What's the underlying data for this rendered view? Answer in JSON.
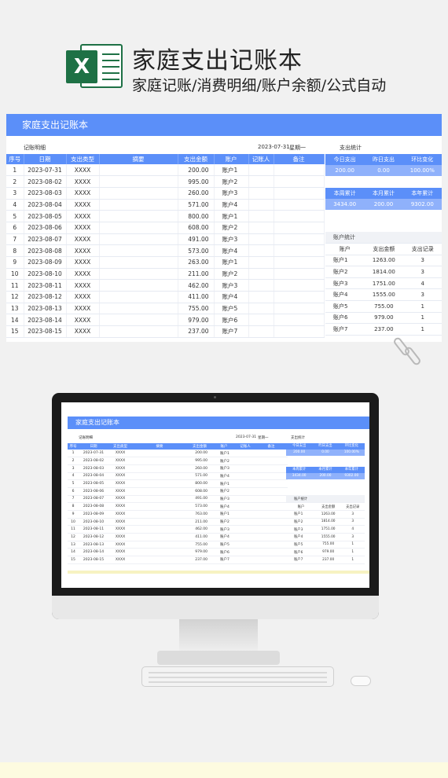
{
  "banner": {
    "logo_letter": "X",
    "title": "家庭支出记账本",
    "subtitle": "家庭记账/消费明细/账户余额/公式自动"
  },
  "sheet": {
    "title": "家庭支出记账本",
    "section_label": "记账明细",
    "date": "2023-07-31",
    "weekday": "星期一",
    "stats_label": "支出统计",
    "columns": [
      "序号",
      "日期",
      "支出类型",
      "摘要",
      "支出金额",
      "账户",
      "记账人",
      "备注"
    ],
    "rows": [
      {
        "no": "1",
        "date": "2023-07-31",
        "type": "XXXX",
        "amount": "200.00",
        "account": "账户1"
      },
      {
        "no": "2",
        "date": "2023-08-02",
        "type": "XXXX",
        "amount": "995.00",
        "account": "账户2"
      },
      {
        "no": "3",
        "date": "2023-08-03",
        "type": "XXXX",
        "amount": "260.00",
        "account": "账户3"
      },
      {
        "no": "4",
        "date": "2023-08-04",
        "type": "XXXX",
        "amount": "571.00",
        "account": "账户4"
      },
      {
        "no": "5",
        "date": "2023-08-05",
        "type": "XXXX",
        "amount": "800.00",
        "account": "账户1"
      },
      {
        "no": "6",
        "date": "2023-08-06",
        "type": "XXXX",
        "amount": "608.00",
        "account": "账户2"
      },
      {
        "no": "7",
        "date": "2023-08-07",
        "type": "XXXX",
        "amount": "491.00",
        "account": "账户3"
      },
      {
        "no": "8",
        "date": "2023-08-08",
        "type": "XXXX",
        "amount": "573.00",
        "account": "账户4"
      },
      {
        "no": "9",
        "date": "2023-08-09",
        "type": "XXXX",
        "amount": "263.00",
        "account": "账户1"
      },
      {
        "no": "10",
        "date": "2023-08-10",
        "type": "XXXX",
        "amount": "211.00",
        "account": "账户2"
      },
      {
        "no": "11",
        "date": "2023-08-11",
        "type": "XXXX",
        "amount": "462.00",
        "account": "账户3"
      },
      {
        "no": "12",
        "date": "2023-08-12",
        "type": "XXXX",
        "amount": "411.00",
        "account": "账户4"
      },
      {
        "no": "13",
        "date": "2023-08-13",
        "type": "XXXX",
        "amount": "755.00",
        "account": "账户5"
      },
      {
        "no": "14",
        "date": "2023-08-14",
        "type": "XXXX",
        "amount": "979.00",
        "account": "账户6"
      },
      {
        "no": "15",
        "date": "2023-08-15",
        "type": "XXXX",
        "amount": "237.00",
        "account": "账户7"
      }
    ],
    "stats1": {
      "labels": [
        "今日支出",
        "昨日支出",
        "环比变化"
      ],
      "values": [
        "200.00",
        "0.00",
        "100.00%"
      ]
    },
    "stats2": {
      "labels": [
        "本周累计",
        "本月累计",
        "本年累计"
      ],
      "values": [
        "3434.00",
        "200.00",
        "9302.00"
      ]
    },
    "account_stats": {
      "title": "账户统计",
      "headers": [
        "账户",
        "支出金额",
        "支出记录"
      ],
      "rows": [
        {
          "name": "账户1",
          "amount": "1263.00",
          "count": "3"
        },
        {
          "name": "账户2",
          "amount": "1814.00",
          "count": "3"
        },
        {
          "name": "账户3",
          "amount": "1751.00",
          "count": "4"
        },
        {
          "name": "账户4",
          "amount": "1555.00",
          "count": "3"
        },
        {
          "name": "账户5",
          "amount": "755.00",
          "count": "1"
        },
        {
          "name": "账户6",
          "amount": "979.00",
          "count": "1"
        },
        {
          "name": "账户7",
          "amount": "237.00",
          "count": "1"
        }
      ]
    }
  },
  "mini": {
    "rows": [
      {
        "amount": "200.00"
      },
      {
        "amount": "995.00"
      },
      {
        "amount": "260.00"
      },
      {
        "amount": "571.00"
      },
      {
        "amount": "800.00"
      },
      {
        "amount": "608.00"
      },
      {
        "amount": "491.00"
      },
      {
        "amount": "573.00"
      },
      {
        "amount": "763.00"
      },
      {
        "amount": "211.00"
      },
      {
        "amount": "462.00"
      },
      {
        "amount": "411.00"
      },
      {
        "amount": "755.00"
      },
      {
        "amount": "979.00"
      },
      {
        "amount": "237.00"
      }
    ],
    "accounts": [
      {
        "name": "账户1",
        "amount": "1263.00",
        "count": "3"
      },
      {
        "name": "账户2",
        "amount": "1814.00",
        "count": "3"
      },
      {
        "name": "账户3",
        "amount": "1751.00",
        "count": "4"
      },
      {
        "name": "账户4",
        "amount": "1555.00",
        "count": "3"
      },
      {
        "name": "账户5",
        "amount": "755.00",
        "count": "1"
      },
      {
        "name": "账户6",
        "amount": "979.00",
        "count": "1"
      },
      {
        "name": "账户7",
        "amount": "237.00",
        "count": "1"
      }
    ]
  },
  "colors": {
    "accent": "#5b8ff9",
    "accent_light": "#8fb1fb",
    "excel_green": "#1e7145"
  },
  "icons": [
    "excel-icon",
    "paperclip-icon",
    "monitor-icon",
    "keyboard-icon",
    "mouse-icon"
  ]
}
